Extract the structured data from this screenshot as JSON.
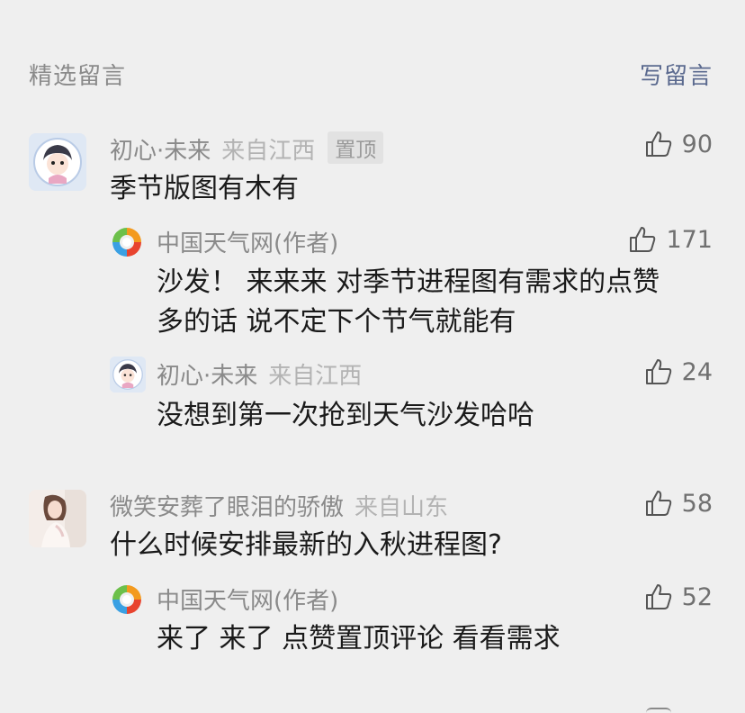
{
  "header": {
    "title": "精选留言",
    "write_label": "写留言"
  },
  "comments": [
    {
      "name": "初心·未来",
      "source": "来自江西",
      "badge": "置顶",
      "text": "季节版图有木有",
      "likes": "90",
      "reply": {
        "name": "中国天气网(作者)",
        "likes": "171",
        "text_line1": "沙发！ 来来来 对季节进程图有需求的点赞",
        "text_line2": "多的话 说不定下个节气就能有"
      },
      "sub": {
        "name": "初心·未来",
        "source": "来自江西",
        "likes": "24",
        "text": "没想到第一次抢到天气沙发哈哈"
      }
    },
    {
      "name": "微笑安葬了眼泪的骄傲",
      "source": "来自山东",
      "text": "什么时候安排最新的入秋进程图?",
      "likes": "58",
      "reply": {
        "name": "中国天气网(作者)",
        "likes": "52",
        "text": "来了 来了 点赞置顶评论 看看需求"
      }
    }
  ],
  "icons": {
    "like": "thumbs-up-icon",
    "logo": "weather-logo-icon"
  },
  "colors": {
    "background": "#efefef",
    "link": "#5b6a8f",
    "muted": "#8a8a8a",
    "text": "#1a1a1a"
  }
}
